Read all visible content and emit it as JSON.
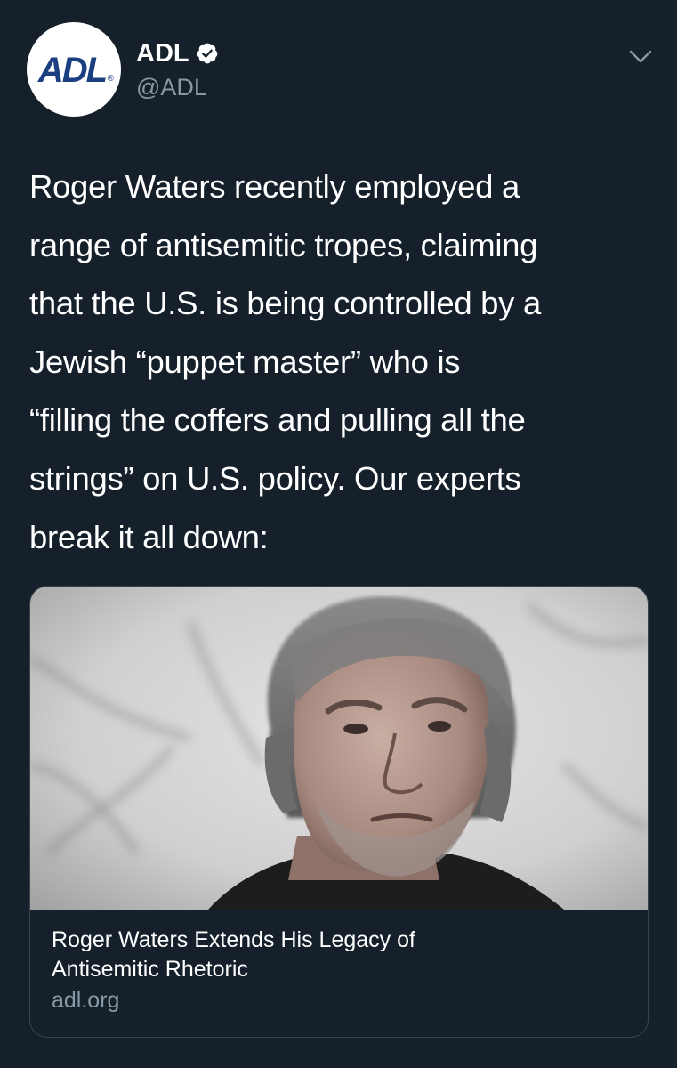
{
  "tweet": {
    "author": {
      "avatar_logo": "ADL",
      "display_name": "ADL",
      "handle": "@ADL",
      "verified": true,
      "verified_icon": "verified-badge-icon"
    },
    "menu_icon": "chevron-down-icon",
    "text": "Roger Waters recently employed a range of antisemitic tropes, claiming that the U.S. is being controlled by a Jewish “puppet master” who is “filling the coffers and pulling all the strings” on U.S. policy. Our experts break it all down:",
    "text_lines": [
      "Roger Waters recently employed a",
      "range of antisemitic tropes, claiming",
      "that the U.S. is being controlled by a",
      "Jewish “puppet master” who is",
      "“filling the coffers and pulling all the",
      "strings” on U.S. policy. Our experts",
      "break it all down:"
    ],
    "link_card": {
      "image": "portrait-photo",
      "title_lines": [
        "Roger Waters Extends His Legacy of",
        "Antisemitic Rhetoric"
      ],
      "domain": "adl.org"
    }
  },
  "colors": {
    "background": "#15202b",
    "text_primary": "#ffffff",
    "text_secondary": "#8899a6",
    "border": "#38444d",
    "logo_blue": "#1b3f80"
  }
}
